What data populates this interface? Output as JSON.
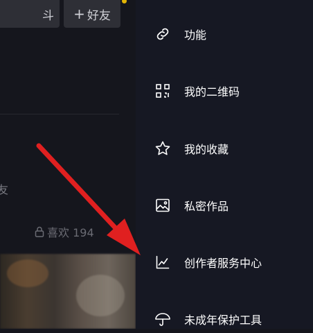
{
  "left_panel": {
    "partial_button_label": "斗",
    "add_friend_label": "好友",
    "add_friend_icon": "+",
    "friends_partial": "友",
    "likes_text": "喜欢 194"
  },
  "menu": {
    "items": [
      {
        "label": "功能",
        "icon": "link-icon"
      },
      {
        "label": "我的二维码",
        "icon": "qrcode-icon"
      },
      {
        "label": "我的收藏",
        "icon": "star-icon"
      },
      {
        "label": "私密作品",
        "icon": "image-icon"
      },
      {
        "label": "创作者服务中心",
        "icon": "chart-icon"
      },
      {
        "label": "未成年保护工具",
        "icon": "umbrella-icon"
      }
    ]
  },
  "colors": {
    "background": "#15161d",
    "menu_background": "#161823",
    "arrow": "#e02020",
    "accent_dot": "#e3b505"
  }
}
